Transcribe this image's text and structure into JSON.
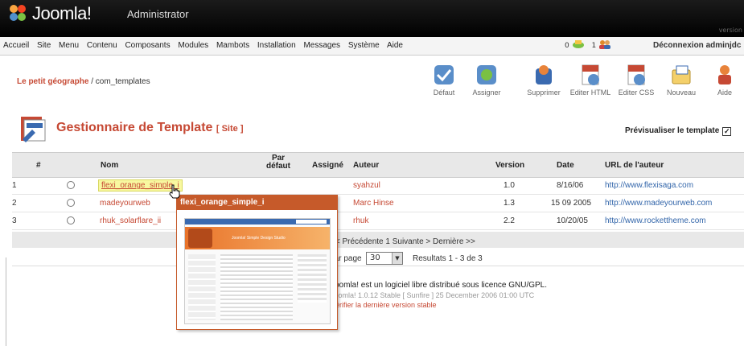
{
  "header": {
    "logo_text": "Joomla!",
    "logo_suffix": "Administrator",
    "version_text": "version"
  },
  "menu": {
    "items": [
      "Accueil",
      "Site",
      "Menu",
      "Contenu",
      "Composants",
      "Modules",
      "Mambots",
      "Installation",
      "Messages",
      "Système",
      "Aide"
    ],
    "messages_count": "0",
    "users_count": "1",
    "logout": "Déconnexion adminjdc"
  },
  "breadcrumb": {
    "site": "Le petit géographe",
    "component": " / com_templates"
  },
  "toolbar": {
    "buttons": [
      "Défaut",
      "Assigner",
      "Supprimer",
      "Editer HTML",
      "Editer CSS",
      "Nouveau",
      "Aide"
    ]
  },
  "page": {
    "title": "Gestionnaire de Template",
    "subtitle": "[ Site ]",
    "preview_label": "Prévisualiser le template",
    "preview_checked": "☑"
  },
  "table": {
    "columns": [
      "#",
      "Nom",
      "Par défaut",
      "Assigné",
      "Auteur",
      "Version",
      "Date",
      "URL de l'auteur"
    ],
    "rows": [
      {
        "num": "1",
        "name": "flexi_orange_simple_i",
        "author": "syahzul",
        "version": "1.0",
        "date": "8/16/06",
        "url": "http://www.flexisaga.com"
      },
      {
        "num": "2",
        "name": "madeyourweb",
        "author": "Marc Hinse",
        "version": "1.3",
        "date": "15 09 2005",
        "url": "http://www.madeyourweb.com"
      },
      {
        "num": "3",
        "name": "rhuk_solarflare_ii",
        "author": "rhuk",
        "version": "2.2",
        "date": "10/20/05",
        "url": "http://www.rockettheme.com"
      }
    ],
    "pagination": "<< Précédente 1 Suivante > Dernière >>",
    "per_page_label": "Par page",
    "per_page_value": "30",
    "results": "Resultats 1 - 3 de 3"
  },
  "footer": {
    "license": "Joomla! est un logiciel libre distribué sous licence GNU/GPL.",
    "version": "Joomla! 1.0.12 Stable [ Sunfire ] 25 December 2006 01:00 UTC",
    "update": "Vérifier la dernière version stable"
  },
  "tooltip": {
    "title": "flexi_orange_simple_i",
    "preview_heading": "Joomla! Simple Design Studio"
  },
  "colors": {
    "accent": "#c64934",
    "header_bg": "#000000",
    "tooltip_border": "#c65a2a"
  }
}
